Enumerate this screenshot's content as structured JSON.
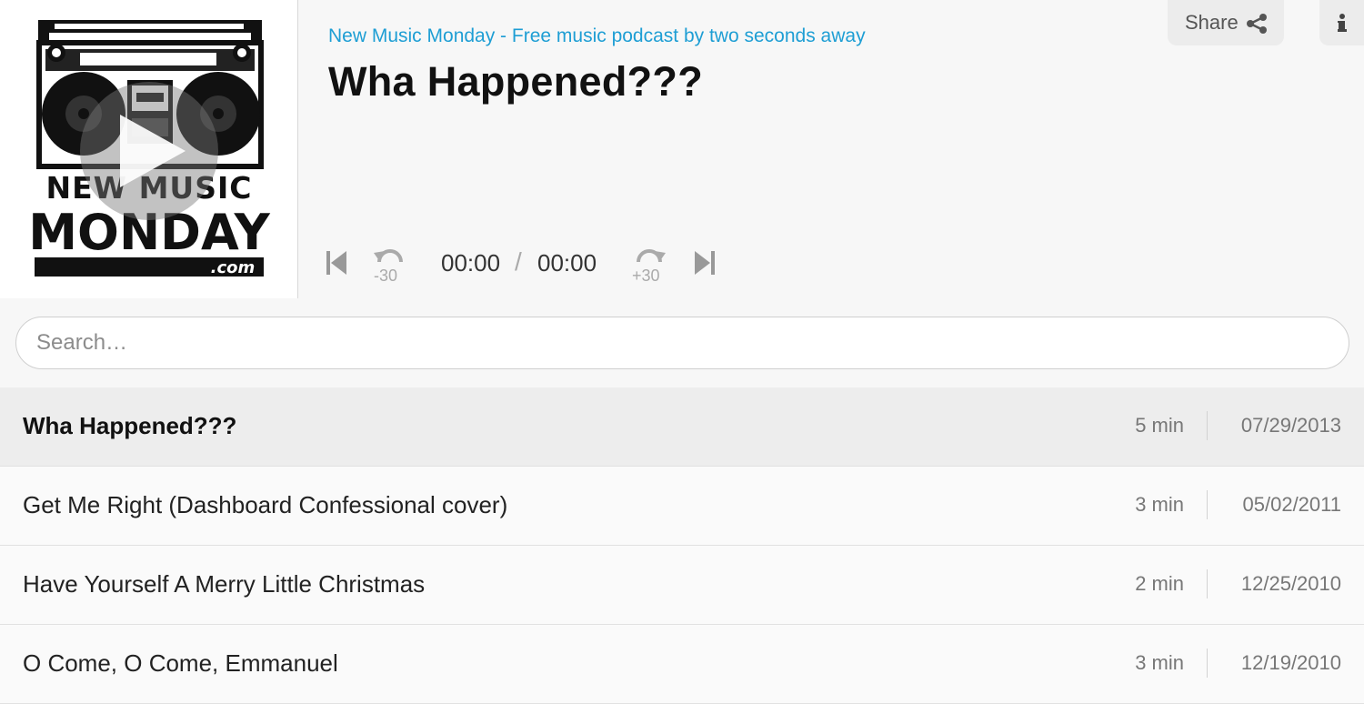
{
  "header": {
    "podcast_title": "New Music Monday - Free music podcast by two seconds away",
    "episode_title": "Wha Happened???",
    "share_label": "Share",
    "cover_alt": "NEW MUSIC MONDAY .com"
  },
  "player": {
    "rewind_label": "-30",
    "forward_label": "+30",
    "current_time": "00:00",
    "separator": "/",
    "total_time": "00:00"
  },
  "search": {
    "placeholder": "Search…"
  },
  "episodes": [
    {
      "title": "Wha Happened???",
      "duration": "5 min",
      "date": "07/29/2013",
      "active": true
    },
    {
      "title": "Get Me Right (Dashboard Confessional cover)",
      "duration": "3 min",
      "date": "05/02/2011"
    },
    {
      "title": "Have Yourself A Merry Little Christmas",
      "duration": "2 min",
      "date": "12/25/2010"
    },
    {
      "title": "O Come, O Come, Emmanuel",
      "duration": "3 min",
      "date": "12/19/2010"
    }
  ],
  "icons": {
    "play": "play-icon",
    "prev": "skip-previous-icon",
    "rewind": "rewind-30-icon",
    "forward": "forward-30-icon",
    "next": "skip-next-icon",
    "share": "share-icon",
    "info": "info-icon"
  },
  "colors": {
    "accent": "#1e9ed4",
    "active_row": "#ededed"
  }
}
